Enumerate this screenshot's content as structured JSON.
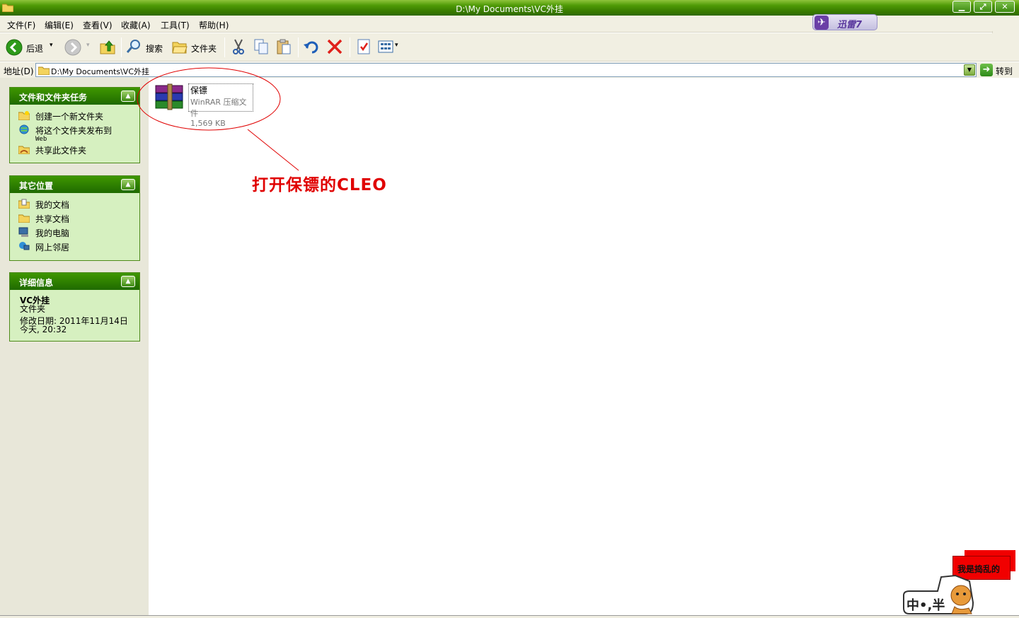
{
  "window": {
    "title": "D:\\My Documents\\VC外挂"
  },
  "menu": [
    "文件(F)",
    "编辑(E)",
    "查看(V)",
    "收藏(A)",
    "工具(T)",
    "帮助(H)"
  ],
  "xunlei": {
    "label": "迅雷7"
  },
  "toolbar": {
    "back": "后退",
    "search": "搜索",
    "folders": "文件夹"
  },
  "address": {
    "label": "地址(D)",
    "path": "D:\\My Documents\\VC外挂",
    "go": "转到"
  },
  "panels": {
    "tasks": {
      "title": "文件和文件夹任务",
      "items": [
        {
          "label": "创建一个新文件夹",
          "icon": "new-folder-icon"
        },
        {
          "label": "将这个文件夹发布到",
          "sub": "Web",
          "icon": "publish-web-icon"
        },
        {
          "label": "共享此文件夹",
          "icon": "share-folder-icon"
        }
      ]
    },
    "places": {
      "title": "其它位置",
      "items": [
        {
          "label": "我的文档",
          "icon": "my-documents-icon"
        },
        {
          "label": "共享文档",
          "icon": "shared-documents-icon"
        },
        {
          "label": "我的电脑",
          "icon": "my-computer-icon"
        },
        {
          "label": "网上邻居",
          "icon": "network-places-icon"
        }
      ]
    },
    "details": {
      "title": "详细信息",
      "name": "VC外挂",
      "type": "文件夹",
      "modified": "修改日期: 2011年11月14日",
      "modified_time": "今天, 20:32"
    }
  },
  "file": {
    "name": "保镖",
    "type": "WinRAR 压缩文件",
    "size": "1,569 KB"
  },
  "annotation": "打开保镖的CLEO",
  "mascot": {
    "flag_text": "我是捣乱的",
    "badge_text": "中•,半"
  },
  "colors": {
    "titlebar": "#3a7d00",
    "panel_header": "#2f8000",
    "panel_body": "#d6f0c0",
    "annotation": "#e00000"
  }
}
